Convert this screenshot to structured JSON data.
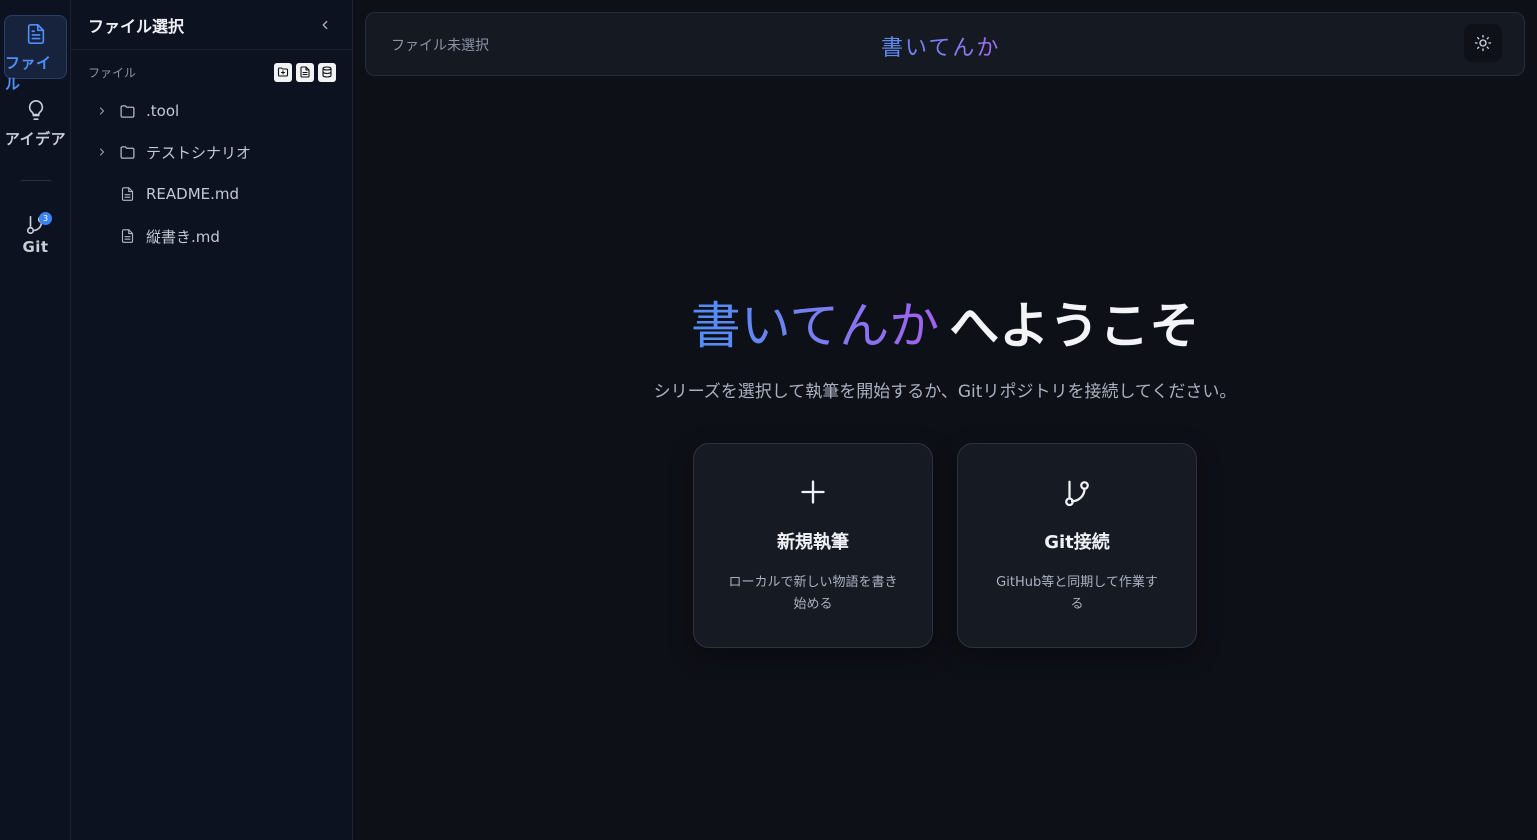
{
  "activity": {
    "items": [
      {
        "label": "ファイル",
        "icon": "file-icon",
        "active": true
      },
      {
        "label": "アイデア",
        "icon": "lightbulb-icon",
        "active": false
      },
      {
        "label": "Git",
        "icon": "git-branch-icon",
        "active": false,
        "badge": "3"
      }
    ]
  },
  "sidebar": {
    "title": "ファイル選択",
    "section_label": "ファイル",
    "tree": [
      {
        "name": ".tool",
        "type": "folder"
      },
      {
        "name": "テストシナリオ",
        "type": "folder"
      },
      {
        "name": "README.md",
        "type": "file"
      },
      {
        "name": "縦書き.md",
        "type": "file"
      }
    ]
  },
  "topbar": {
    "status": "ファイル未選択",
    "brand": "書いてんか"
  },
  "welcome": {
    "brand": "書いてんか",
    "suffix": "へようこそ",
    "description": "シリーズを選択して執筆を開始するか、Gitリポジトリを接続してください。"
  },
  "cards": [
    {
      "title": "新規執筆",
      "description": "ローカルで新しい物語を書き始める",
      "icon": "plus-icon"
    },
    {
      "title": "Git接続",
      "description": "GitHub等と同期して作業する",
      "icon": "git-branch-icon"
    }
  ],
  "colors": {
    "accent": "#4f8ff7",
    "brand_gradient_start": "#4f8ff7",
    "brand_gradient_end": "#a35ff0",
    "badge": "#3b82f6"
  }
}
